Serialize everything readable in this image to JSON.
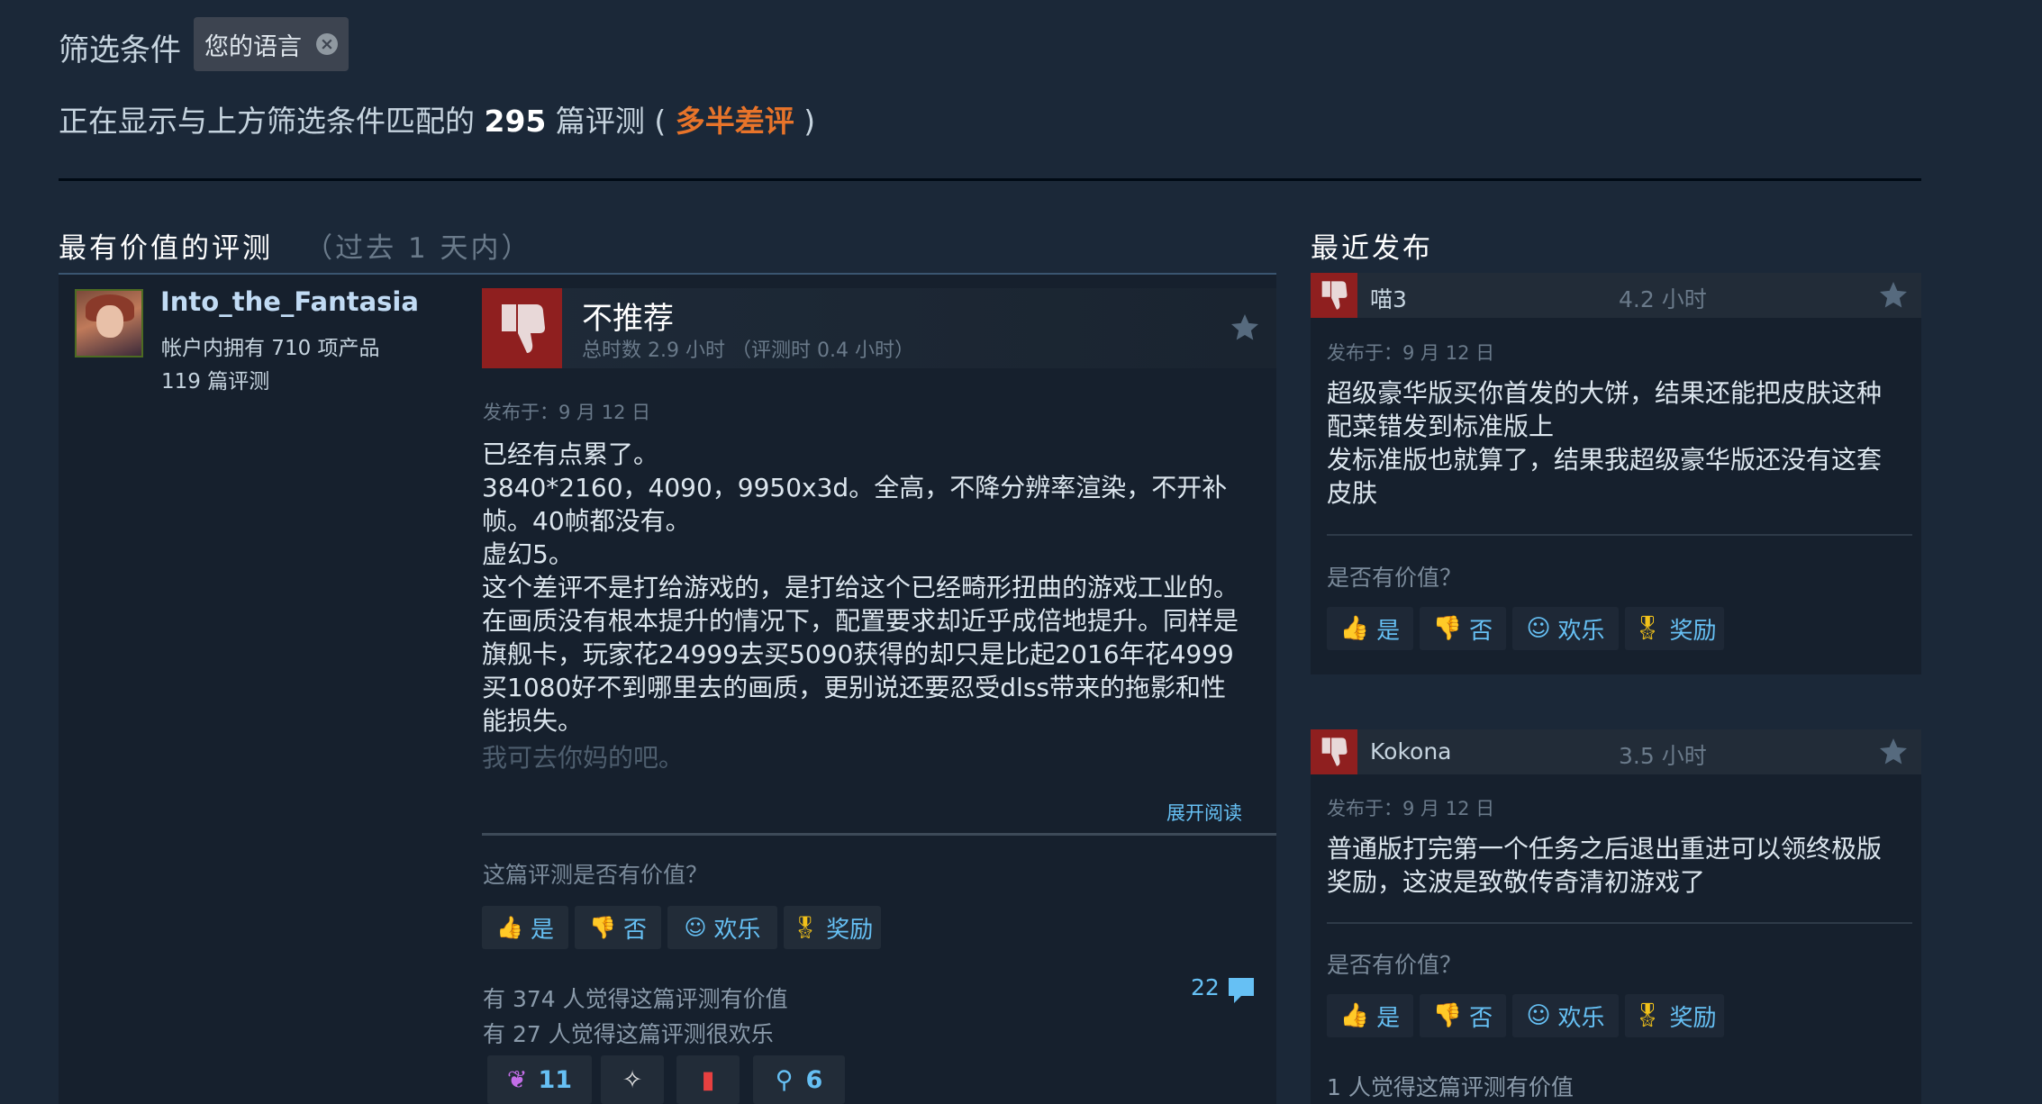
{
  "filter": {
    "label": "筛选条件",
    "chip_label": "您的语言",
    "chip_close": "×"
  },
  "summary": {
    "prefix": "正在显示与上方筛选条件匹配的",
    "count": "295",
    "suffix": "篇评测 (",
    "rating": "多半差评",
    "close": ")"
  },
  "helpful": {
    "title": "最有价值的评测",
    "subtitle": "（过去 1 天内）"
  },
  "recent": {
    "title": "最近发布"
  },
  "main_review": {
    "author": {
      "name": "Into_the_Fantasia",
      "products": "帐户内拥有 710 项产品",
      "reviews": "119 篇评测"
    },
    "verdict": "不推荐",
    "hours": "总时数 2.9 小时 （评测时 0.4 小时）",
    "posted": "发布于：9 月 12 日",
    "lines": [
      "已经有点累了。",
      "3840*2160，4090，9950x3d。全高，不降分辨率渲染，不开补",
      "帧。40帧都没有。",
      "虚幻5。",
      "这个差评不是打给游戏的，是打给这个已经畸形扭曲的游戏工业的。",
      "在画质没有根本提升的情况下，配置要求却近乎成倍地提升。同样是",
      "旗舰卡，玩家花24999去买5090获得的却只是比起2016年花4999",
      "买1080好不到哪里去的画质，更别说还要忍受dlss带来的拖影和性",
      "能损失。"
    ],
    "faded_line": "我可去你妈的吧。",
    "expand": "展开阅读",
    "question": "这篇评测是否有价值？",
    "buttons": {
      "yes": "是",
      "no": "否",
      "funny": "欢乐",
      "award": "奖励"
    },
    "helpful_count": "有 374 人觉得这篇评测有价值",
    "funny_count": "有 27 人觉得这篇评测很欢乐",
    "comments": "22",
    "awards": [
      {
        "icon": "heart-wings-icon",
        "count": "11"
      },
      {
        "icon": "wings-icon",
        "count": ""
      },
      {
        "icon": "juice-box-icon",
        "count": ""
      },
      {
        "icon": "ribbon-award-icon",
        "count": "6"
      }
    ]
  },
  "recent_reviews": [
    {
      "name": "喵3",
      "hours": "4.2 小时",
      "posted": "发布于：9 月 12 日",
      "lines": [
        "超级豪华版买你首发的大饼，结果还能把皮肤这种",
        "配菜错发到标准版上",
        "发标准版也就算了，结果我超级豪华版还没有这套",
        "皮肤"
      ],
      "question": "是否有价值？",
      "buttons": {
        "yes": "是",
        "no": "否",
        "funny": "欢乐",
        "award": "奖励"
      }
    },
    {
      "name": "Kokona",
      "hours": "3.5 小时",
      "posted": "发布于：9 月 12 日",
      "lines": [
        "普通版打完第一个任务之后退出重进可以领终极版",
        "奖励，这波是致敬传奇清初游戏了"
      ],
      "question": "是否有价值？",
      "buttons": {
        "yes": "是",
        "no": "否",
        "funny": "欢乐",
        "award": "奖励"
      },
      "helpful_count": "1 人觉得这篇评测有价值"
    }
  ],
  "colors": {
    "background": "#1b2838",
    "negative": "#e8742a",
    "link": "#66c0f4",
    "thumb_down": "#8f1f1f"
  }
}
